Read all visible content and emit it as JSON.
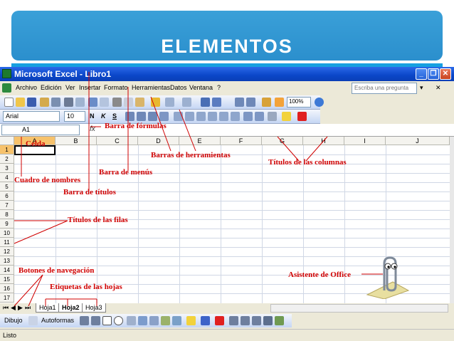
{
  "slide": {
    "title": "ELEMENTOS"
  },
  "window": {
    "title": "Microsoft Excel - Libro1",
    "buttons": {
      "minimize": "_",
      "restore": "❐",
      "close": "✕"
    }
  },
  "menu": {
    "items": [
      "Archivo",
      "Edición",
      "Ver",
      "Insertar",
      "Formato",
      "Herramientas",
      "Datos",
      "Ventana",
      "?"
    ],
    "ask_placeholder": "Escriba una pregunta"
  },
  "standard_toolbar": {
    "zoom": "100%"
  },
  "format_toolbar": {
    "font": "Arial",
    "size": "10",
    "bold": "N",
    "italic": "K",
    "underline": "S"
  },
  "formula_bar": {
    "name_box": "A1",
    "fx": "fx"
  },
  "grid": {
    "columns": [
      "A",
      "B",
      "C",
      "D",
      "E",
      "F",
      "G",
      "H",
      "I",
      "J"
    ],
    "rows": [
      "1",
      "2",
      "3",
      "4",
      "5",
      "6",
      "7",
      "8",
      "9",
      "10",
      "11",
      "12",
      "13",
      "14",
      "15",
      "16",
      "17"
    ]
  },
  "sheets": {
    "tabs": [
      "Hoja1",
      "Hoja2",
      "Hoja3"
    ],
    "active": "Hoja2",
    "nav": [
      "⏮",
      "◀",
      "▶",
      "⏭"
    ]
  },
  "drawing_toolbar": {
    "draw": "Dibujo",
    "autoshapes": "Autoformas"
  },
  "status": {
    "text": "Listo"
  },
  "annotations": {
    "formula_bar": "Barra de fórmulas",
    "cell": "Celda",
    "toolbars": "Barras de herramientas",
    "column_titles": "Títulos de las columnas",
    "menu_bar": "Barra de menús",
    "name_box": "Cuadro de nombres",
    "title_bar": "Barra de títulos",
    "row_titles": "Títulos de las filas",
    "nav_buttons": "Botones de navegación",
    "sheet_tabs": "Etiquetas de las hojas",
    "office_assistant": "Asistente de Office"
  },
  "colors": {
    "banner": "#2b8fcd",
    "titlebar": "#0a46c8",
    "annotation": "#d00000",
    "selected_header": "#f7c26b"
  }
}
